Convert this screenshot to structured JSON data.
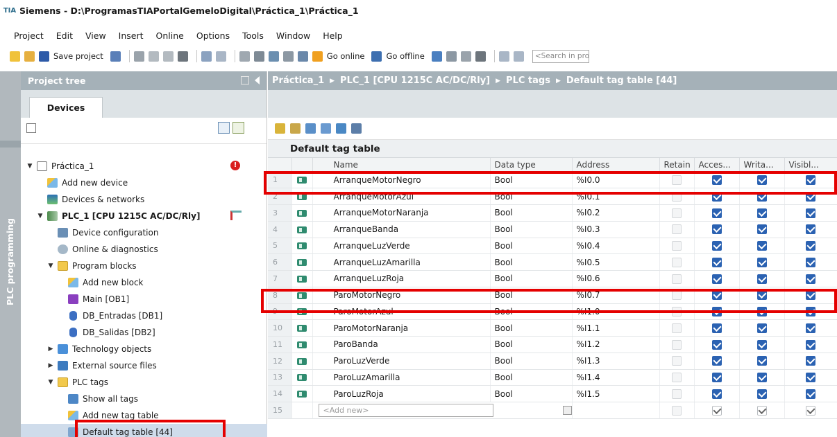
{
  "window": {
    "title": "Siemens - D:\\ProgramasTIAPortalGemeloDigital\\Práctica_1\\Práctica_1",
    "logo_text": "TIA"
  },
  "menu": [
    "Project",
    "Edit",
    "View",
    "Insert",
    "Online",
    "Options",
    "Tools",
    "Window",
    "Help"
  ],
  "toolbar": {
    "save_label": "Save project",
    "go_online_label": "Go online",
    "go_offline_label": "Go offline",
    "search_placeholder": "<Search in project>"
  },
  "sidebar": {
    "vertical_tab": "PLC programming"
  },
  "project_tree": {
    "header": "Project tree",
    "tab": "Devices",
    "items": [
      {
        "label": "Práctica_1",
        "level": 0,
        "arrow": "down",
        "icon": "project-icon"
      },
      {
        "label": "Add new device",
        "level": 1,
        "arrow": "",
        "icon": "add-device-icon"
      },
      {
        "label": "Devices & networks",
        "level": 1,
        "arrow": "",
        "icon": "network-icon"
      },
      {
        "label": "PLC_1 [CPU 1215C AC/DC/Rly]",
        "level": 1,
        "arrow": "down",
        "icon": "plc-icon"
      },
      {
        "label": "Device configuration",
        "level": 2,
        "arrow": "",
        "icon": "device-config-icon"
      },
      {
        "label": "Online & diagnostics",
        "level": 2,
        "arrow": "",
        "icon": "diagnostics-icon"
      },
      {
        "label": "Program blocks",
        "level": 2,
        "arrow": "down",
        "icon": "folder-icon"
      },
      {
        "label": "Add new block",
        "level": 3,
        "arrow": "",
        "icon": "add-block-icon"
      },
      {
        "label": "Main [OB1]",
        "level": 3,
        "arrow": "",
        "icon": "main-block-icon"
      },
      {
        "label": "DB_Entradas [DB1]",
        "level": 3,
        "arrow": "",
        "icon": "data-block-icon"
      },
      {
        "label": "DB_Salidas [DB2]",
        "level": 3,
        "arrow": "",
        "icon": "data-block-icon"
      },
      {
        "label": "Technology objects",
        "level": 2,
        "arrow": "right",
        "icon": "technology-icon"
      },
      {
        "label": "External source files",
        "level": 2,
        "arrow": "right",
        "icon": "external-source-icon"
      },
      {
        "label": "PLC tags",
        "level": 2,
        "arrow": "down",
        "icon": "folder-icon"
      },
      {
        "label": "Show all tags",
        "level": 3,
        "arrow": "",
        "icon": "show-tags-icon"
      },
      {
        "label": "Add new tag table",
        "level": 3,
        "arrow": "",
        "icon": "add-table-icon"
      },
      {
        "label": "Default tag table [44]",
        "level": 3,
        "arrow": "",
        "icon": "tag-table-icon"
      }
    ]
  },
  "breadcrumb": [
    "Práctica_1",
    "PLC_1 [CPU 1215C AC/DC/Rly]",
    "PLC tags",
    "Default tag table [44]"
  ],
  "tag_table": {
    "title": "Default tag table",
    "columns": [
      "",
      "",
      "Name",
      "Data type",
      "Address",
      "Retain",
      "Acces...",
      "Writa...",
      "Visibl..."
    ],
    "rows": [
      {
        "num": "1",
        "name": "ArranqueMotorNegro",
        "type": "Bool",
        "address": "%I0.0"
      },
      {
        "num": "2",
        "name": "ArranqueMotorAzul",
        "type": "Bool",
        "address": "%I0.1"
      },
      {
        "num": "3",
        "name": "ArranqueMotorNaranja",
        "type": "Bool",
        "address": "%I0.2"
      },
      {
        "num": "4",
        "name": "ArranqueBanda",
        "type": "Bool",
        "address": "%I0.3"
      },
      {
        "num": "5",
        "name": "ArranqueLuzVerde",
        "type": "Bool",
        "address": "%I0.4"
      },
      {
        "num": "6",
        "name": "ArranqueLuzAmarilla",
        "type": "Bool",
        "address": "%I0.5"
      },
      {
        "num": "7",
        "name": "ArranqueLuzRoja",
        "type": "Bool",
        "address": "%I0.6"
      },
      {
        "num": "8",
        "name": "ParoMotorNegro",
        "type": "Bool",
        "address": "%I0.7"
      },
      {
        "num": "9",
        "name": "ParoMotorAzul",
        "type": "Bool",
        "address": "%I1.0"
      },
      {
        "num": "10",
        "name": "ParoMotorNaranja",
        "type": "Bool",
        "address": "%I1.1"
      },
      {
        "num": "11",
        "name": "ParoBanda",
        "type": "Bool",
        "address": "%I1.2"
      },
      {
        "num": "12",
        "name": "ParoLuzVerde",
        "type": "Bool",
        "address": "%I1.3"
      },
      {
        "num": "13",
        "name": "ParoLuzAmarilla",
        "type": "Bool",
        "address": "%I1.4"
      },
      {
        "num": "14",
        "name": "ParoLuzRoja",
        "type": "Bool",
        "address": "%I1.5"
      }
    ],
    "add_new_row": {
      "num": "15",
      "placeholder": "<Add new>"
    }
  },
  "colors": {
    "header_bar": "#a5b1b8",
    "checkbox_checked": "#2b62b2",
    "highlight": "#e50000",
    "tag_icon": "#2f8b6f"
  }
}
